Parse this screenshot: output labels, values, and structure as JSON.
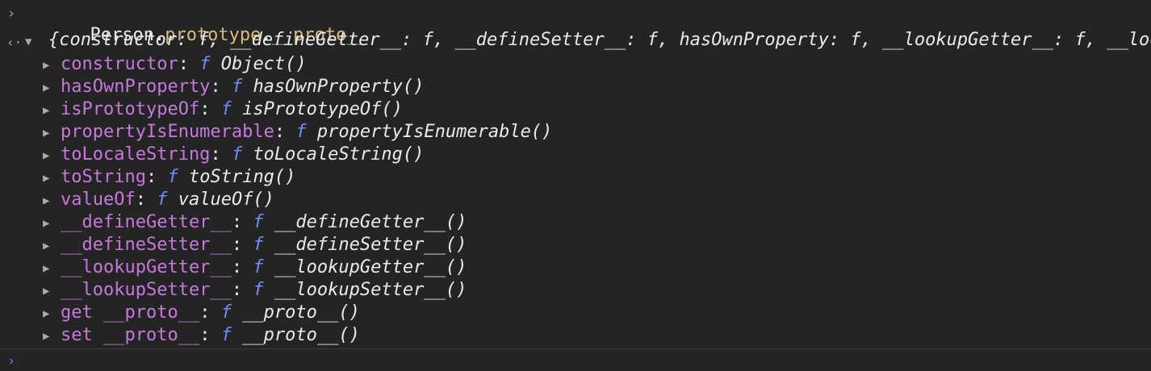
{
  "input": {
    "prompt": "›",
    "expression_prefix": "Person.",
    "expression_prototype": "prototype",
    "expression_dot": ".",
    "expression_proto": "__proto__"
  },
  "result": {
    "marker": "‹·",
    "expand_icon": "▼",
    "summary": "{constructor: f, __defineGetter__: f, __defineSetter__: f, hasOwnProperty: f, __lookupGetter__: f, __lookupSetter__: f, isPrototypeOf: f, …}"
  },
  "properties": [
    {
      "key": "constructor",
      "fn": "f",
      "signature": "Object()"
    },
    {
      "key": "hasOwnProperty",
      "fn": "f",
      "signature": "hasOwnProperty()"
    },
    {
      "key": "isPrototypeOf",
      "fn": "f",
      "signature": "isPrototypeOf()"
    },
    {
      "key": "propertyIsEnumerable",
      "fn": "f",
      "signature": "propertyIsEnumerable()"
    },
    {
      "key": "toLocaleString",
      "fn": "f",
      "signature": "toLocaleString()"
    },
    {
      "key": "toString",
      "fn": "f",
      "signature": "toString()"
    },
    {
      "key": "valueOf",
      "fn": "f",
      "signature": "valueOf()"
    },
    {
      "key": "__defineGetter__",
      "fn": "f",
      "signature": "__defineGetter__()"
    },
    {
      "key": "__defineSetter__",
      "fn": "f",
      "signature": "__defineSetter__()"
    },
    {
      "key": "__lookupGetter__",
      "fn": "f",
      "signature": "__lookupGetter__()"
    },
    {
      "key": "__lookupSetter__",
      "fn": "f",
      "signature": "__lookupSetter__()"
    },
    {
      "key": "get __proto__",
      "fn": "f",
      "signature": "__proto__()"
    },
    {
      "key": "set __proto__",
      "fn": "f",
      "signature": "__proto__()"
    }
  ],
  "console": {
    "cursor_prompt": "›"
  },
  "icons": {
    "prompt": "chevron-right-icon",
    "result_marker": "result-arrow-icon",
    "expand": "caret-down-icon",
    "collapsed": "caret-right-icon"
  },
  "colors": {
    "background": "#242424",
    "property_key": "#c678dd",
    "function_marker": "#6c8cff",
    "prototype_highlight": "#d7ba7d"
  }
}
